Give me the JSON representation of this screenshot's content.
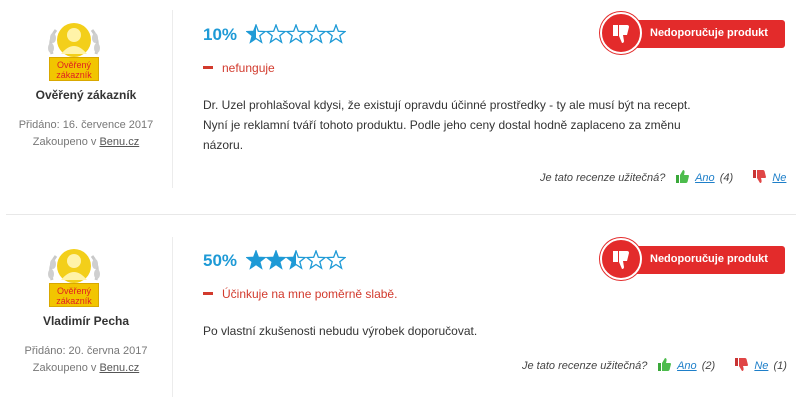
{
  "reviews": [
    {
      "badge_label": "Ověřený zákazník",
      "author": "Ověřený zákazník",
      "added": "Přidáno: 16. července 2017",
      "bought_prefix": "Zakoupeno v",
      "bought_shop": "Benu.cz",
      "percent": "10%",
      "rating_fraction": 0.1,
      "not_recommended_label": "Nedoporučuje produkt",
      "con": "nefunguje",
      "body": [
        "Dr. Uzel prohlašoval kdysi, že existují opravdu účinné prostředky - ty ale musí být na recept.",
        "Nyní je reklamní tváří tohoto produktu. Podle jeho ceny dostal hodně zaplaceno za změnu",
        "názoru."
      ],
      "helpful_question": "Je tato recenze užitečná?",
      "yes_label": "Ano",
      "yes_count": "(4)",
      "no_label": "Ne",
      "no_count": ""
    },
    {
      "badge_label": "Ověřený zákazník",
      "author": "Vladimír Pecha",
      "added": "Přidáno: 20. června 2017",
      "bought_prefix": "Zakoupeno v",
      "bought_shop": "Benu.cz",
      "percent": "50%",
      "rating_fraction": 0.5,
      "not_recommended_label": "Nedoporučuje produkt",
      "con": "Účinkuje na mne poměrně slabě.",
      "body": [
        "Po vlastní zkušenosti nebudu výrobek doporučovat."
      ],
      "helpful_question": "Je tato recenze užitečná?",
      "yes_label": "Ano",
      "yes_count": "(2)",
      "no_label": "Ne",
      "no_count": "(1)"
    }
  ],
  "colors": {
    "accent_blue": "#1e9ad6",
    "danger_red": "#e32b2b",
    "con_red": "#d23a2d",
    "badge_gold": "#f2c500"
  },
  "icons": {
    "badge": "verified-customer-badge-icon",
    "star": "star-icon",
    "not_recommended": "thumbs-down-icon",
    "like": "thumbs-up-icon",
    "dislike": "thumbs-down-small-icon"
  }
}
